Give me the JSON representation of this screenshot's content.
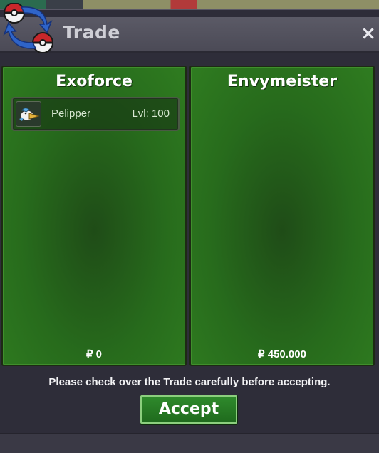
{
  "window": {
    "title": "Trade",
    "close_glyph": "×"
  },
  "left_panel": {
    "player_name": "Exoforce",
    "items": [
      {
        "name": "Pelipper",
        "level": "Lvl: 100",
        "icon": "pelipper-icon"
      }
    ],
    "money": "₽ 0"
  },
  "right_panel": {
    "player_name": "Envymeister",
    "items": [],
    "money": "₽ 450.000"
  },
  "footer": {
    "notice": "Please check over the Trade carefully before accepting.",
    "accept_label": "Accept"
  },
  "colors": {
    "panel_green": "#276b1c",
    "accent_green": "#2f8a2c",
    "window_bg": "#2e2d39"
  }
}
